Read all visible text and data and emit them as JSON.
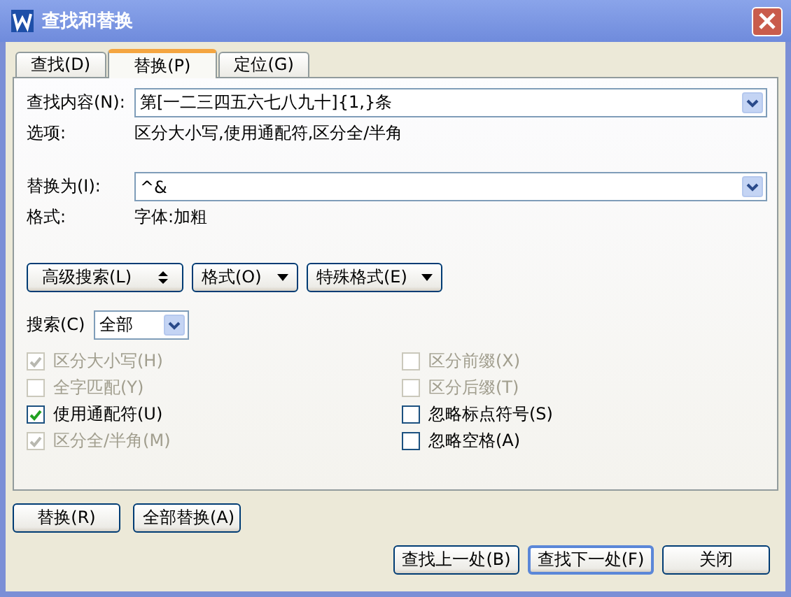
{
  "window": {
    "title": "查找和替换"
  },
  "tabs": [
    {
      "label": "查找(D)",
      "selected": false
    },
    {
      "label": "替换(P)",
      "selected": true
    },
    {
      "label": "定位(G)",
      "selected": false
    }
  ],
  "find": {
    "label": "查找内容(N):",
    "value": "第[一二三四五六七八九十]{1,}条"
  },
  "find_options": {
    "label": "选项:",
    "value": "区分大小写,使用通配符,区分全/半角"
  },
  "replace": {
    "label": "替换为(I):",
    "value": "^&"
  },
  "replace_format": {
    "label": "格式:",
    "value": "字体:加粗"
  },
  "option_buttons": [
    {
      "label": "高级搜索(L)",
      "kind": "toggle"
    },
    {
      "label": "格式(O)",
      "kind": "menu"
    },
    {
      "label": "特殊格式(E)",
      "kind": "menu"
    }
  ],
  "search": {
    "label": "搜索(C)",
    "value": "全部"
  },
  "checkboxes_left": [
    {
      "label": "区分大小写(H)",
      "checked": true,
      "disabled": true
    },
    {
      "label": "全字匹配(Y)",
      "checked": false,
      "disabled": true
    },
    {
      "label": "使用通配符(U)",
      "checked": true,
      "disabled": false
    },
    {
      "label": "区分全/半角(M)",
      "checked": true,
      "disabled": true
    }
  ],
  "checkboxes_right": [
    {
      "label": "区分前缀(X)",
      "checked": false,
      "disabled": true
    },
    {
      "label": "区分后缀(T)",
      "checked": false,
      "disabled": true
    },
    {
      "label": "忽略标点符号(S)",
      "checked": false,
      "disabled": false
    },
    {
      "label": "忽略空格(A)",
      "checked": false,
      "disabled": false
    }
  ],
  "replace_buttons": [
    {
      "label": "替换(R)",
      "focused": false
    },
    {
      "label": "全部替换(A)",
      "focused": false
    }
  ],
  "nav_buttons": [
    {
      "label": "查找上一处(B)",
      "focused": false
    },
    {
      "label": "查找下一处(F)",
      "focused": true
    },
    {
      "label": "关闭",
      "focused": false
    }
  ]
}
